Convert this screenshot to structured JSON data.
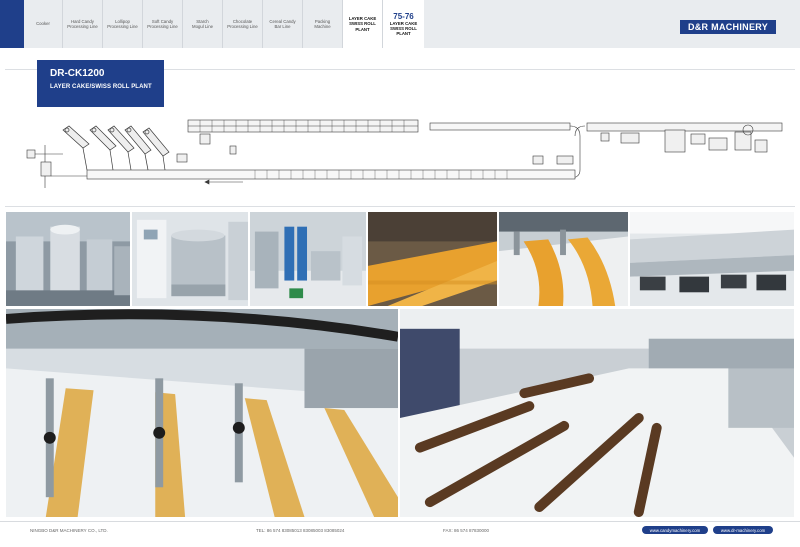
{
  "nav": {
    "items": [
      "Cooker",
      "Hard Candy\nProcessing Line",
      "Lollipop\nProcessing Line",
      "Soft Candy\nProcessing Line",
      "Starch\nMogul Line",
      "Chocolate\nProcessing Line",
      "Cereal Candy\nBar Line",
      "Packing\nMachine",
      "LAYER CAKE\nSWISS ROLL PLANT"
    ],
    "current_page": "75-76",
    "current_label": "LAYER CAKE\nSWISS ROLL PLANT"
  },
  "company_tag": "D&R MACHINERY",
  "title": {
    "model": "DR-CK1200",
    "plant": "LAYER CAKE/SWISS ROLL PLANT"
  },
  "footer": {
    "company": "NINGBO D&R MACHINERY CO., LTD.",
    "tel": "TEL: 86 574 83085013 83085003 83085024",
    "fax": "FAX: 86 574 87830000",
    "link1": "www.candymachinery.com",
    "link2": "www.dr-machinery.com"
  },
  "colors": {
    "brand_blue": "#1f3f8a",
    "nav_bg": "#e9ecef",
    "sponge_orange": "#e8a12e"
  }
}
